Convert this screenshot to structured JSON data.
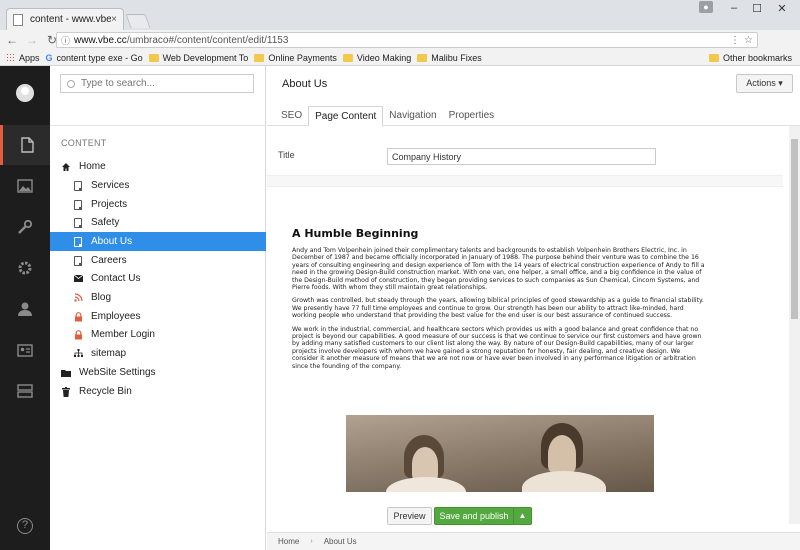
{
  "browser": {
    "tab_title": "content - www.vbe.cc",
    "tab_close": "×",
    "url_host": "www.vbe.cc",
    "url_path": "/umbraco#/content/content/edit/1153",
    "window_controls": [
      "–",
      "☐",
      "✕"
    ],
    "bookmarks": [
      {
        "label": "Apps",
        "type": "apps"
      },
      {
        "label": "content type exe - Go",
        "type": "google"
      },
      {
        "label": "Web Development To",
        "type": "folder"
      },
      {
        "label": "Online Payments",
        "type": "folder"
      },
      {
        "label": "Video Making",
        "type": "folder"
      },
      {
        "label": "Malibu Fixes",
        "type": "folder"
      }
    ],
    "other_bookmarks": "Other bookmarks"
  },
  "sidebar": {
    "search_placeholder": "Type to search...",
    "section_title": "CONTENT",
    "nodes": [
      {
        "label": "Home",
        "icon": "home-icon",
        "level": 0
      },
      {
        "label": "Services",
        "icon": "document-icon",
        "level": 1
      },
      {
        "label": "Projects",
        "icon": "document-icon",
        "level": 1
      },
      {
        "label": "Safety",
        "icon": "document-icon",
        "level": 1
      },
      {
        "label": "About Us",
        "icon": "document-icon",
        "level": 1,
        "active": true
      },
      {
        "label": "Careers",
        "icon": "document-icon",
        "level": 1
      },
      {
        "label": "Contact Us",
        "icon": "envelope-icon",
        "level": 1
      },
      {
        "label": "Blog",
        "icon": "rss-icon",
        "level": 1
      },
      {
        "label": "Employees",
        "icon": "lock-icon",
        "level": 1
      },
      {
        "label": "Member Login",
        "icon": "lock-icon",
        "level": 1
      },
      {
        "label": "sitemap",
        "icon": "sitemap-icon",
        "level": 1
      },
      {
        "label": "WebSite Settings",
        "icon": "folder-icon",
        "level": 0
      },
      {
        "label": "Recycle Bin",
        "icon": "trash-icon",
        "level": 0
      }
    ]
  },
  "editor": {
    "page_title": "About Us",
    "actions_label": "Actions ▾",
    "tabs": [
      "SEO",
      "Page Content",
      "Navigation",
      "Properties"
    ],
    "selected_tab": 1,
    "title_label": "Title",
    "title_value": "Company History",
    "content": {
      "heading": "A Humble Beginning",
      "paragraphs": [
        "Andy and Tom Volpenhein joined their complimentary talents and backgrounds to establish Volpenhein Brothers Electric, Inc. in December of 1987 and became officially incorporated in January of 1988.  The purpose behind their venture was to combine the 16 years of consulting engineering and design experience of Tom with the 14 years of electrical construction experience of Andy to fill a need in the growing Design-Build construction market.  With one van, one helper, a small office, and a big confidence in the value of the Design-Build method of construction, they began providing services to such companies as Sun Chemical, Cincom Systems, and Pierre foods.  With whom they still maintain great relationships.",
        "Growth was controlled, but steady through the years, allowing biblical principles of good stewardship as a guide to financial stability.  We presently have 77 full time employees and continue to grow.  Our strength has been our ability to attract like-minded, hard working people who understand that providing the best value for the end user is our best assurance of continued success.",
        "We work in the industrial, commercial, and healthcare sectors which provides us with a good balance and great confidence that no project is beyond our capabilities.  A good measure of our success is that we continue to service our first customers and have grown by adding many satisfied customers to our client list along the way. By nature of our Design-Build capabilities, many of our larger projects involve developers with whom we have gained a strong reputation for honesty, fair dealing, and creative design.  We consider it another measure of means that we are not now or have ever been involved in any performance litigation or arbitration since the founding of the company."
      ]
    },
    "preview_label": "Preview",
    "save_label": "Save and publish",
    "breadcrumb": [
      "Home",
      "About Us"
    ]
  },
  "colors": {
    "rail_bg": "#1d1d1d",
    "active_node": "#2e8ee8",
    "save_green": "#53a93f",
    "rail_accent": "#e35c3d"
  }
}
